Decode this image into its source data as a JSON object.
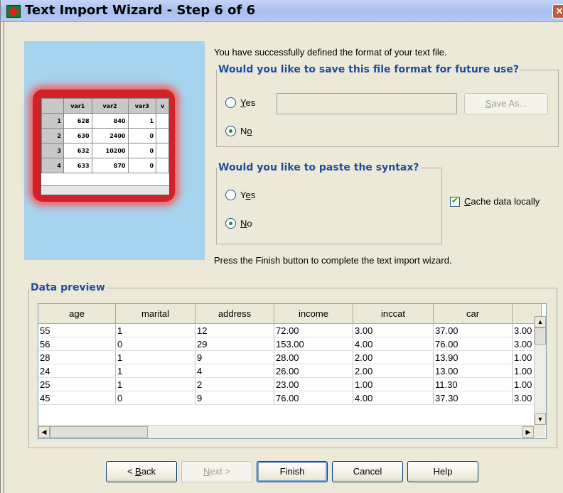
{
  "window": {
    "title": "Text Import Wizard - Step 6 of 6",
    "close_glyph": "✕"
  },
  "preview": {
    "headers": [
      "",
      "var1",
      "var2",
      "var3",
      "v"
    ],
    "rows": [
      [
        "1",
        "628",
        "840",
        "1"
      ],
      [
        "2",
        "630",
        "2400",
        "0"
      ],
      [
        "3",
        "632",
        "10200",
        "0"
      ],
      [
        "4",
        "633",
        "870",
        "0"
      ]
    ]
  },
  "intro_text": "You have successfully defined the format of your text file.",
  "save_group": {
    "legend": "Would you like to save this file format for future use?",
    "yes": {
      "mnemonic": "Y",
      "rest": "es",
      "selected": false
    },
    "no": {
      "lead": "N",
      "mnemonic": "o",
      "selected": true
    },
    "filename_value": "",
    "save_as_label": {
      "lead": "",
      "mnemonic": "S",
      "rest": "ave As..."
    }
  },
  "syntax_group": {
    "legend": "Would you like to paste the syntax?",
    "yes": {
      "lead": "Y",
      "mnemonic": "e",
      "rest": "s",
      "selected": false
    },
    "no": {
      "mnemonic": "N",
      "rest": "o",
      "selected": true
    }
  },
  "cache": {
    "mnemonic": "C",
    "rest": "ache data locally",
    "checked": true
  },
  "finish_text": "Press the Finish button to complete the text import wizard.",
  "data_preview": {
    "legend": "Data preview",
    "columns": [
      "age",
      "marital",
      "address",
      "income",
      "inccat",
      "car",
      ""
    ],
    "rows": [
      [
        "55",
        "1",
        "12",
        "72.00",
        "3.00",
        "37.00",
        "3.00"
      ],
      [
        "56",
        "0",
        "29",
        "153.00",
        "4.00",
        "76.00",
        "3.00"
      ],
      [
        "28",
        "1",
        "9",
        "28.00",
        "2.00",
        "13.90",
        "1.00"
      ],
      [
        "24",
        "1",
        "4",
        "26.00",
        "2.00",
        "13.00",
        "1.00"
      ],
      [
        "25",
        "1",
        "2",
        "23.00",
        "1.00",
        "11.30",
        "1.00"
      ],
      [
        "45",
        "0",
        "9",
        "76.00",
        "4.00",
        "37.30",
        "3.00"
      ]
    ]
  },
  "buttons": {
    "back": {
      "lead": "< ",
      "mnemonic": "B",
      "rest": "ack"
    },
    "next": {
      "lead": "",
      "mnemonic": "N",
      "rest": "ext >"
    },
    "finish": "Finish",
    "cancel": "Cancel",
    "help": "Help"
  }
}
